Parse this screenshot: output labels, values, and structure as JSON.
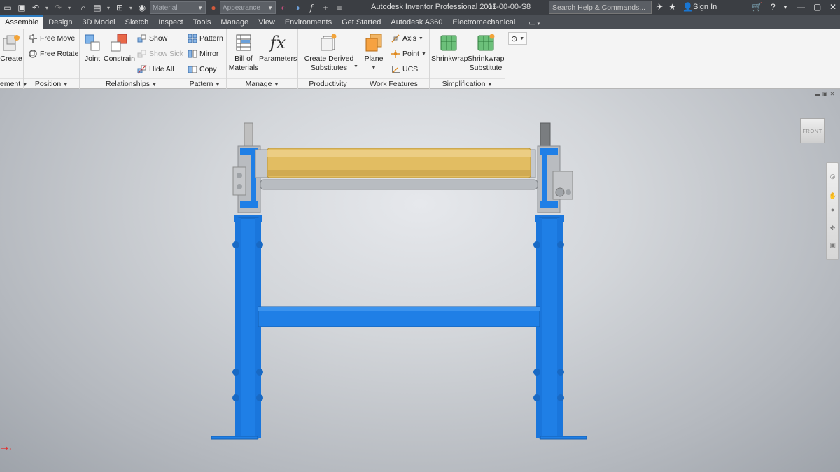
{
  "titlebar": {
    "material_placeholder": "Material",
    "appearance_placeholder": "Appearance",
    "app_title": "Autodesk Inventor Professional 2018",
    "file_name": "01-00-00-S8",
    "search_placeholder": "Search Help & Commands...",
    "sign_in": "Sign In"
  },
  "tabs": [
    "Assemble",
    "Design",
    "3D Model",
    "Sketch",
    "Inspect",
    "Tools",
    "Manage",
    "View",
    "Environments",
    "Get Started",
    "Autodesk A360",
    "Electromechanical"
  ],
  "ribbon": {
    "component": {
      "create": "Create",
      "label": "ement"
    },
    "position": {
      "free_move": "Free Move",
      "free_rotate": "Free Rotate",
      "label": "Position"
    },
    "relationships": {
      "joint": "Joint",
      "constrain": "Constrain",
      "show": "Show",
      "show_sick": "Show Sick",
      "hide_all": "Hide All",
      "label": "Relationships"
    },
    "pattern": {
      "pattern": "Pattern",
      "mirror": "Mirror",
      "copy": "Copy",
      "label": "Pattern"
    },
    "manage": {
      "bom_line1": "Bill of",
      "bom_line2": "Materials",
      "parameters": "Parameters",
      "label": "Manage"
    },
    "productivity": {
      "create_derived_line1": "Create Derived",
      "create_derived_line2": "Substitutes",
      "label": "Productivity"
    },
    "work_features": {
      "plane": "Plane",
      "axis": "Axis",
      "point": "Point",
      "ucs": "UCS",
      "label": "Work Features"
    },
    "simplification": {
      "shrinkwrap": "Shrinkwrap",
      "shrinkwrap_sub_line1": "Shrinkwrap",
      "shrinkwrap_sub_line2": "Substitute",
      "label": "Simplification"
    }
  },
  "viewport": {
    "viewcube_label": "FRONT"
  },
  "colors": {
    "frame_blue": "#1f7fe6",
    "roller_yellow": "#e2bd62",
    "titlebar_bg": "#3b3e43",
    "tabs_bg": "#4a4e54",
    "ribbon_bg": "#f4f4f4"
  }
}
